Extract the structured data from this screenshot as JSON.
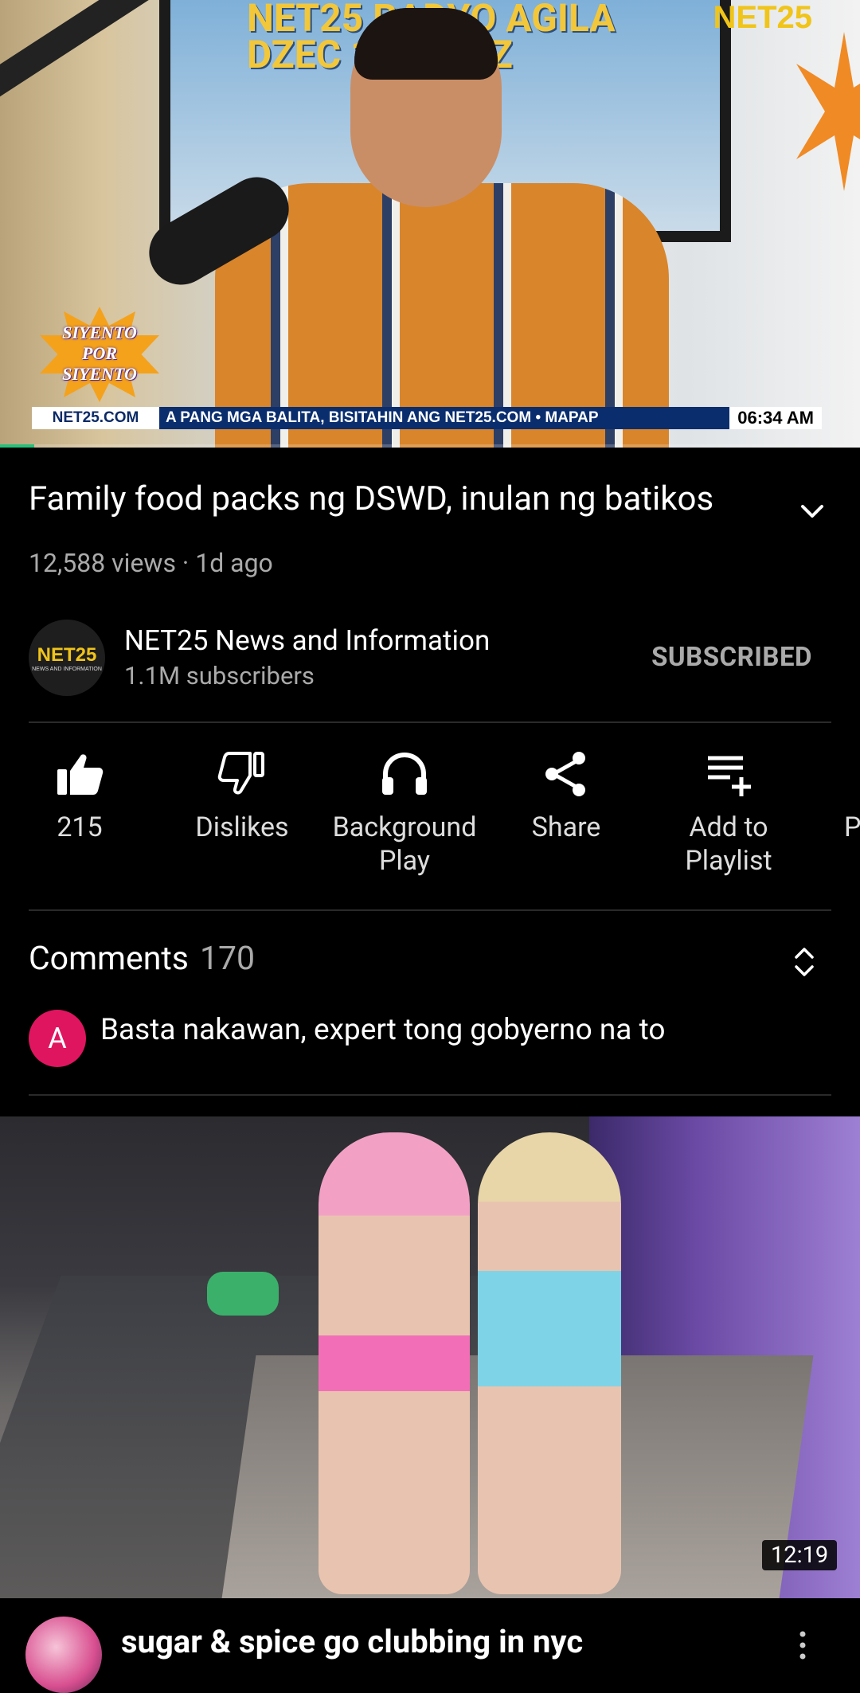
{
  "player": {
    "station_line1": "NET25 RADYO AGILA",
    "station_line2": "DZEC 1062KHZ",
    "corner_logo": "NET25",
    "show_logo": "SIYENTO POR SIYENTO",
    "ticker_brand": "NET25.COM",
    "ticker_text": "A PANG MGA BALITA, BISITAHIN ANG NET25.COM • MAPAP",
    "ticker_time": "06:34 AM",
    "progress_fraction": 0.04,
    "progress_color": "#27c07a"
  },
  "video": {
    "title": "Family food packs ng DSWD, inulan ng batikos",
    "meta": "12,588 views · 1d ago"
  },
  "channel": {
    "avatar_logo": "NET25",
    "avatar_sub": "NEWS AND INFORMATION",
    "name": "NET25 News and Information",
    "subscribers": "1.1M subscribers",
    "subscribe_label": "SUBSCRIBED"
  },
  "actions": [
    {
      "label": "215",
      "icon": "thumbs-up-icon"
    },
    {
      "label": "Dislikes",
      "icon": "thumbs-down-icon"
    },
    {
      "label": "Background Play",
      "icon": "headphones-icon"
    },
    {
      "label": "Share",
      "icon": "share-icon"
    },
    {
      "label": "Add to Playlist",
      "icon": "playlist-add-icon"
    },
    {
      "label": "P",
      "icon": "popup-icon"
    }
  ],
  "comments": {
    "heading": "Comments",
    "count": "170",
    "first": {
      "avatar_letter": "A",
      "text": "Basta nakawan, expert tong gobyerno na to"
    },
    "avatar_color": "#e0155f"
  },
  "next_video": {
    "duration": "12:19",
    "title": "sugar & spice go clubbing in nyc"
  }
}
